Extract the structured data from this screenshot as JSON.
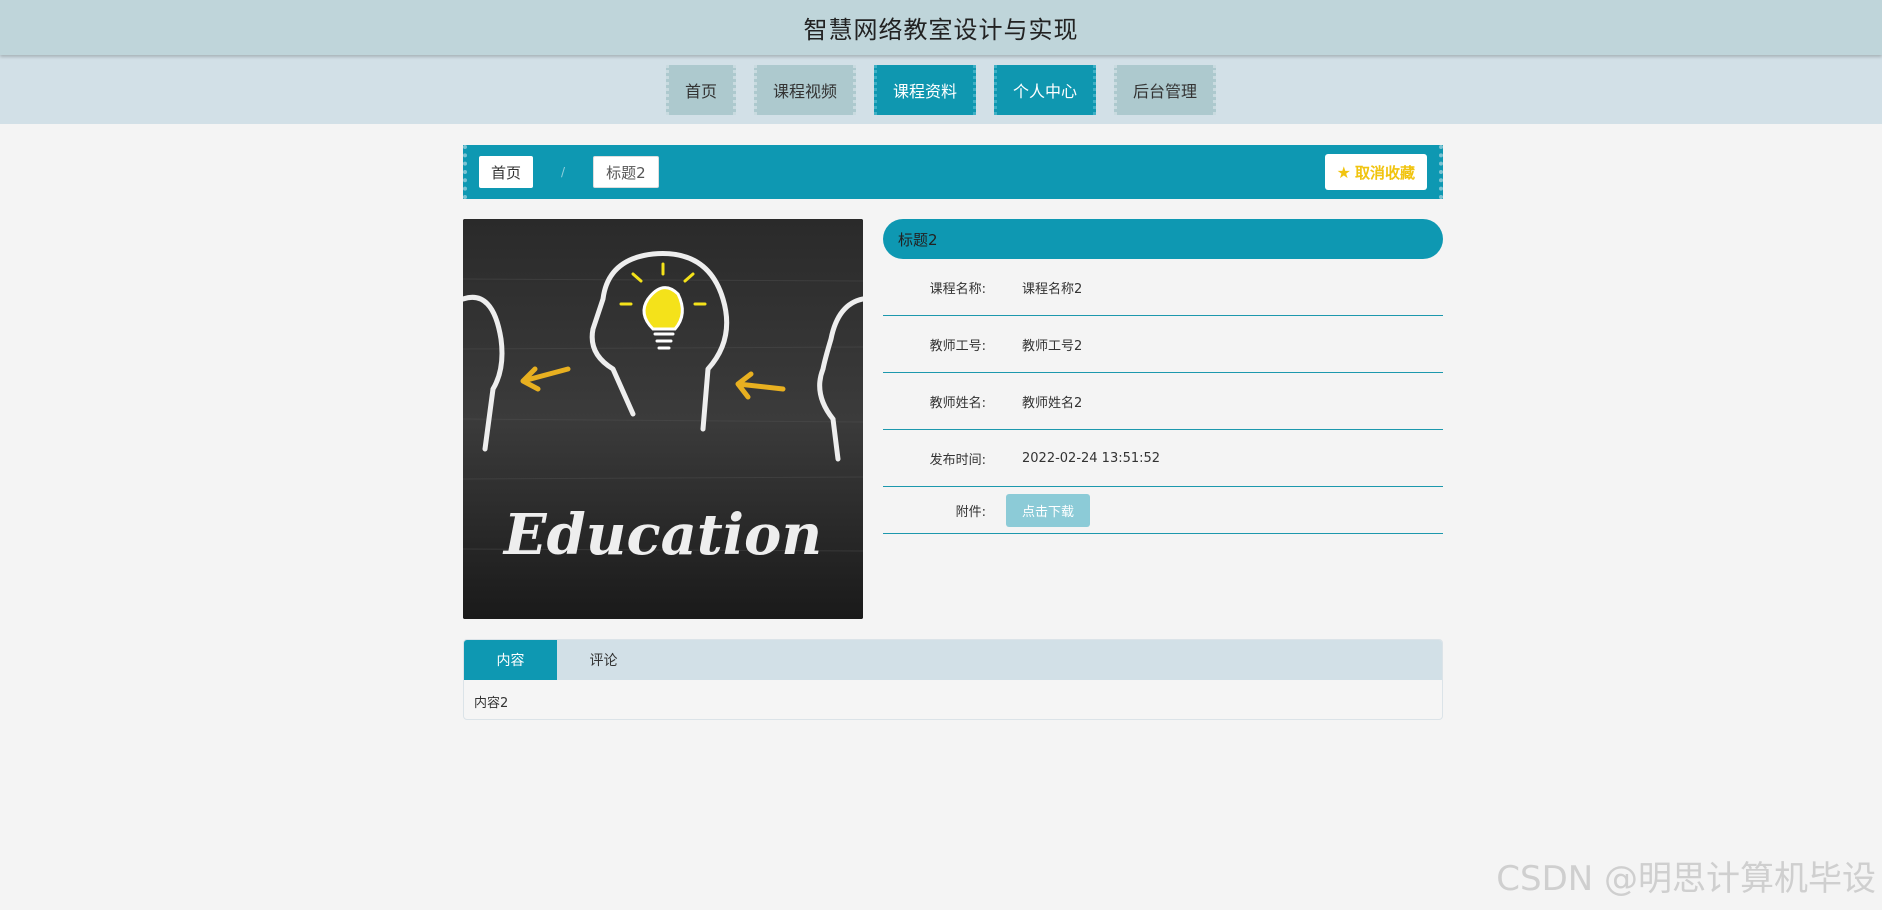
{
  "header": {
    "site_title": "智慧网络教室设计与实现"
  },
  "nav": {
    "items": [
      {
        "label": "首页"
      },
      {
        "label": "课程视频"
      },
      {
        "label": "课程资料"
      },
      {
        "label": "个人中心"
      },
      {
        "label": "后台管理"
      }
    ]
  },
  "breadcrumb": {
    "home": "首页",
    "separator": "/",
    "current": "标题2",
    "fav_label": "取消收藏",
    "fav_icon": "star-icon",
    "fav_color": "#f1c40f"
  },
  "cover": {
    "word": "Education"
  },
  "detail": {
    "title": "标题2",
    "rows": [
      {
        "label": "课程名称:",
        "value": "课程名称2"
      },
      {
        "label": "教师工号:",
        "value": "教师工号2"
      },
      {
        "label": "教师姓名:",
        "value": "教师姓名2"
      },
      {
        "label": "发布时间:",
        "value": "2022-02-24 13:51:52"
      }
    ],
    "attachment_label": "附件:",
    "download_label": "点击下载"
  },
  "tabs": {
    "items": [
      {
        "label": "内容"
      },
      {
        "label": "评论"
      }
    ],
    "content": "内容2"
  },
  "watermark": "CSDN @明思计算机毕设",
  "theme": {
    "accent": "#0e98b2",
    "header_bg": "#bfd5da",
    "nav_bg": "#d2e0e7"
  }
}
